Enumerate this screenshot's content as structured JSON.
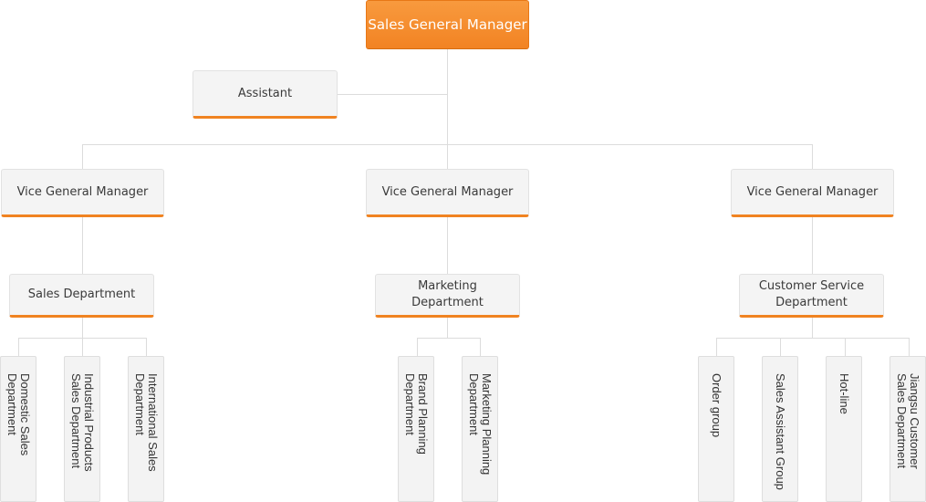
{
  "diagram": {
    "type": "org-chart",
    "accent_color": "#f08321",
    "root": {
      "label": "Sales General Manager"
    },
    "assistant": {
      "label": "Assistant"
    },
    "vice_managers": [
      {
        "label": "Vice General Manager",
        "department": {
          "label": "Sales Department",
          "groups": [
            "Domestic Sales\nDepartment",
            "Industrial Products\nSales Department",
            "International Sales\nDepartment"
          ]
        }
      },
      {
        "label": "Vice General Manager",
        "department": {
          "label": "Marketing\nDepartment",
          "groups": [
            "Brand Planning\nDepartment",
            "Marketing Planning\nDepartment"
          ]
        }
      },
      {
        "label": "Vice General Manager",
        "department": {
          "label": "Customer Service\nDepartment",
          "groups": [
            "Order group",
            "Sales Assistant Group",
            "Hot-line",
            "Jiangsu Customer\nSales Department"
          ]
        }
      }
    ]
  }
}
